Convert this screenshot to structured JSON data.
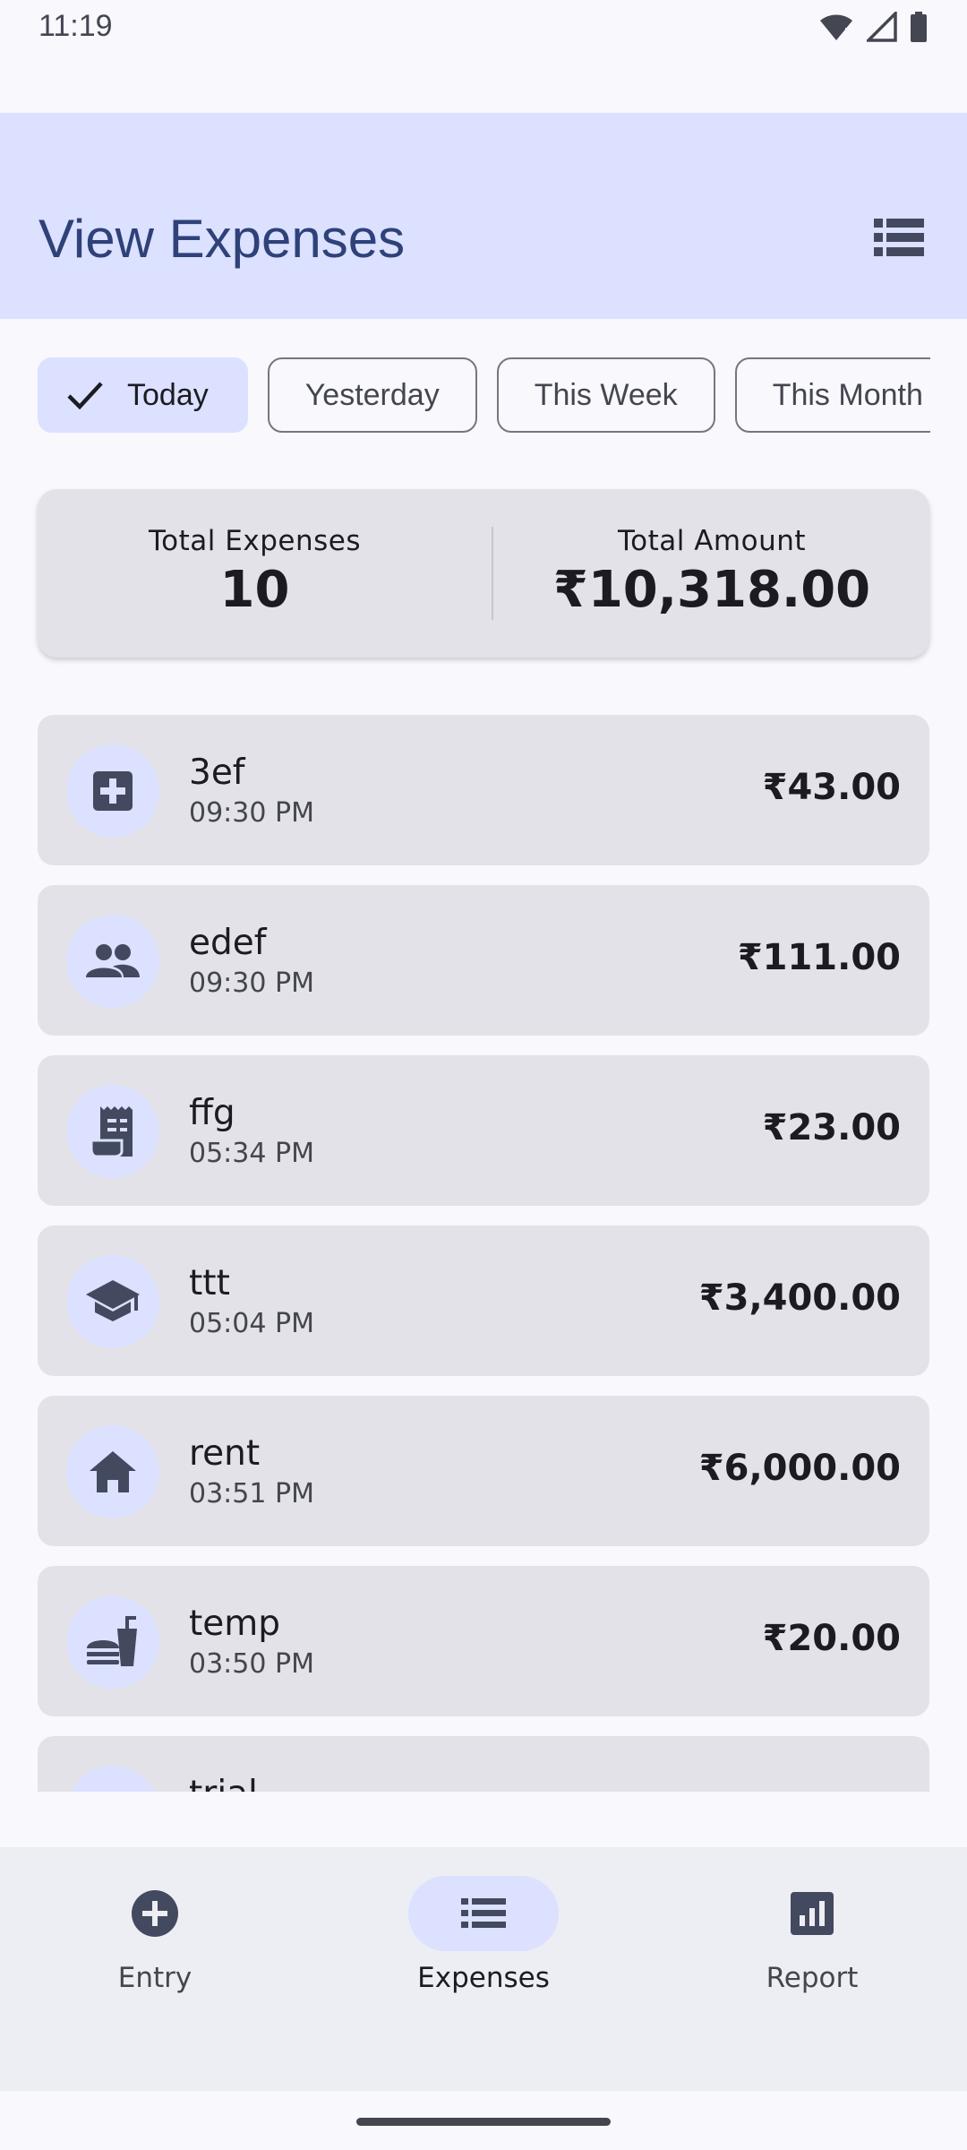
{
  "status_bar": {
    "time": "11:19",
    "icons": [
      "wifi-icon",
      "signal-icon",
      "battery-icon"
    ]
  },
  "app_bar": {
    "title": "View Expenses",
    "action_icon": "view-list-icon"
  },
  "filters": {
    "chips": [
      {
        "label": "Today",
        "selected": true
      },
      {
        "label": "Yesterday",
        "selected": false
      },
      {
        "label": "This Week",
        "selected": false
      },
      {
        "label": "This Month",
        "selected": false
      }
    ]
  },
  "summary": {
    "count_label": "Total Expenses",
    "count_value": "10",
    "amount_label": "Total Amount",
    "amount_value": "₹10,318.00"
  },
  "expenses": [
    {
      "name": "3ef",
      "time": "09:30 PM",
      "amount": "₹43.00",
      "icon": "medical-icon"
    },
    {
      "name": "edef",
      "time": "09:30 PM",
      "amount": "₹111.00",
      "icon": "people-icon"
    },
    {
      "name": "ffg",
      "time": "05:34 PM",
      "amount": "₹23.00",
      "icon": "receipt-icon"
    },
    {
      "name": "ttt",
      "time": "05:04 PM",
      "amount": "₹3,400.00",
      "icon": "school-icon"
    },
    {
      "name": "rent",
      "time": "03:51 PM",
      "amount": "₹6,000.00",
      "icon": "home-icon"
    },
    {
      "name": "temp",
      "time": "03:50 PM",
      "amount": "₹20.00",
      "icon": "fastfood-icon"
    },
    {
      "name": "trial",
      "time": "",
      "amount": "",
      "icon": "add-icon"
    }
  ],
  "bottom_nav": {
    "items": [
      {
        "label": "Entry",
        "icon": "add-circle-icon",
        "active": false
      },
      {
        "label": "Expenses",
        "icon": "list-icon",
        "active": true
      },
      {
        "label": "Report",
        "icon": "chart-icon",
        "active": false
      }
    ]
  },
  "colors": {
    "accent_container": "#dbe1fe",
    "title": "#2f4179",
    "icon": "#434a5f",
    "card": "#e3e2e8"
  }
}
